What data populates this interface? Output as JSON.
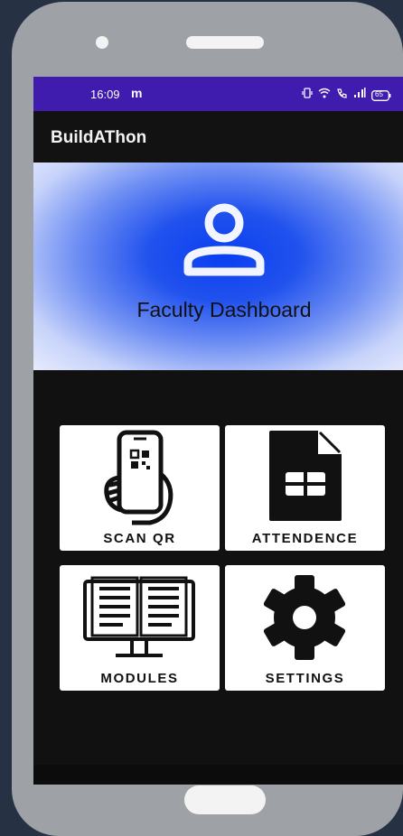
{
  "statusbar": {
    "time": "16:09",
    "carrier_glyph": "m",
    "battery": "65"
  },
  "appbar": {
    "title": "BuildAThon"
  },
  "hero": {
    "icon": "person-icon",
    "title": "Faculty Dashboard"
  },
  "tiles": [
    {
      "label": "SCAN QR",
      "icon": "qr-scan-phone-icon"
    },
    {
      "label": "ATTENDENCE",
      "icon": "spreadsheet-icon"
    },
    {
      "label": "MODULES",
      "icon": "open-book-icon"
    },
    {
      "label": "SETTINGS",
      "icon": "gear-icon"
    }
  ],
  "colors": {
    "statusbar": "#3f1cae",
    "hero_center": "#0a3ff0",
    "background": "#111111",
    "tile": "#ffffff"
  }
}
